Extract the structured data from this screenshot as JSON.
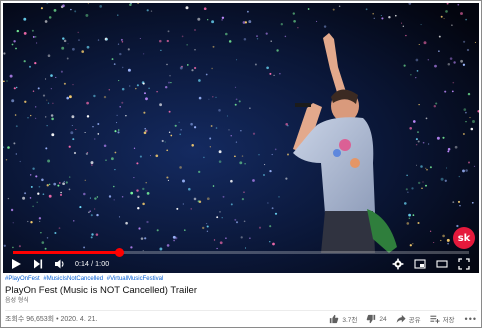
{
  "video": {
    "current_time": "0:14",
    "duration": "1:00",
    "progress": 0.233,
    "channel_watermark": "sk"
  },
  "info": {
    "hashtags": [
      "#PlayOnFest",
      "#MusicIsNotCancelled",
      "#VirtualMusicFestival"
    ],
    "title": "PlayOn Fest (Music is NOT Cancelled) Trailer",
    "subtitle": "음성 형식",
    "views": "조회수 96,653회",
    "date": "2020. 4. 21."
  },
  "actions": {
    "like_count": "3.7천",
    "dislike_count": "24",
    "share_label": "공유",
    "save_label": "저장",
    "more_label": "•••"
  },
  "icons": {
    "play": "play-icon",
    "next": "next-icon",
    "volume": "volume-icon",
    "settings": "gear-icon",
    "miniplayer": "miniplayer-icon",
    "theater": "theater-icon",
    "fullscreen": "fullscreen-icon",
    "like": "thumbs-up-icon",
    "dislike": "thumbs-down-icon",
    "share": "share-icon",
    "save": "save-icon"
  },
  "colors": {
    "progress": "#ff0000",
    "link": "#065fd4",
    "logo": "#e5193c"
  }
}
